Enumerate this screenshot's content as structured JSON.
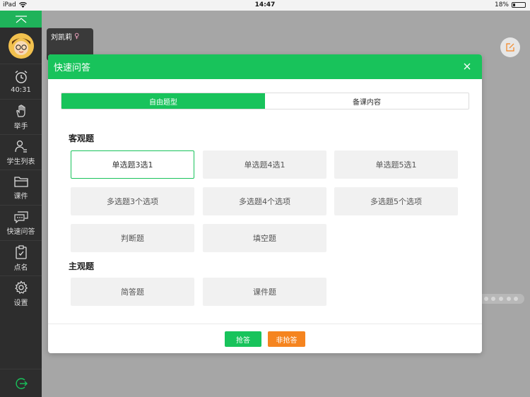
{
  "statusbar": {
    "device": "iPad",
    "time": "14:47",
    "battery": "18%",
    "battery_level": 0.18
  },
  "sidebar": {
    "items": [
      {
        "icon": "alarm-clock-icon",
        "label": "40:31"
      },
      {
        "icon": "raise-hand-icon",
        "label": "举手"
      },
      {
        "icon": "student-list-icon",
        "label": "学生列表"
      },
      {
        "icon": "folder-icon",
        "label": "课件"
      },
      {
        "icon": "chat-question-icon",
        "label": "快速问答"
      },
      {
        "icon": "clipboard-icon",
        "label": "点名"
      },
      {
        "icon": "gear-icon",
        "label": "设置"
      }
    ]
  },
  "student_card": {
    "name": "刘凯莉",
    "gender_symbol": "♀"
  },
  "modal": {
    "title": "快速问答",
    "tabs": [
      {
        "label": "自由题型",
        "active": true
      },
      {
        "label": "备课内容",
        "active": false
      }
    ],
    "objective": {
      "title": "客观题",
      "rows": [
        [
          "单选题3选1",
          "单选题4选1",
          "单选题5选1"
        ],
        [
          "多选题3个选项",
          "多选题4个选项",
          "多选题5个选项"
        ],
        [
          "判断题",
          "填空题"
        ]
      ],
      "selected": "单选题3选1"
    },
    "subjective": {
      "title": "主观题",
      "items": [
        "简答题",
        "课件题"
      ]
    },
    "footer": {
      "grab_label": "抢答",
      "no_grab_label": "非抢答"
    }
  },
  "colors": {
    "accent": "#18c35b",
    "orange": "#f5841f",
    "sidebar": "#2d2d2d"
  }
}
